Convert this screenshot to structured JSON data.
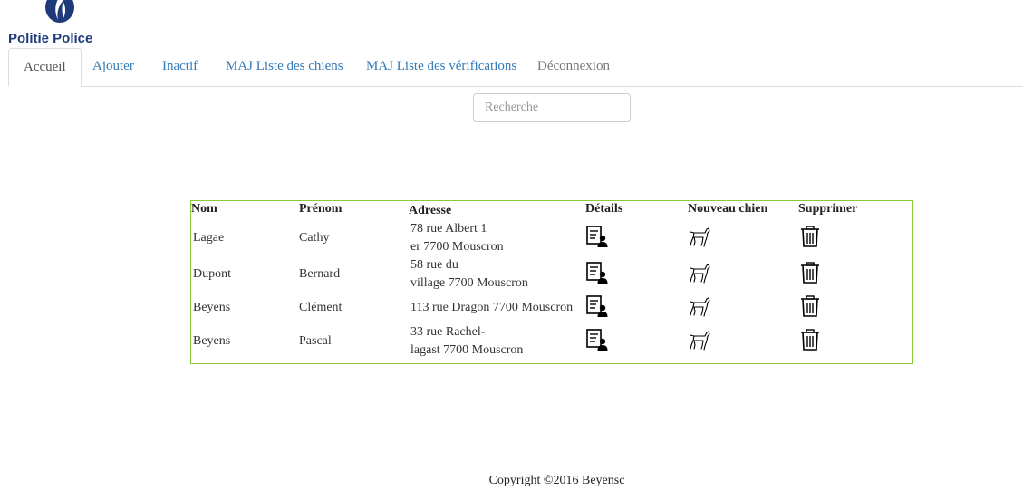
{
  "brand": {
    "logo_icon": "police-logo-icon",
    "name": "Politie Police",
    "color": "#1f3a7a"
  },
  "nav": {
    "tabs": [
      {
        "label": "Accueil",
        "active": true
      },
      {
        "label": "Ajouter"
      },
      {
        "label": "Inactif"
      },
      {
        "label": "MAJ Liste des chiens"
      },
      {
        "label": "MAJ Liste des vérifications"
      },
      {
        "label": "Déconnexion"
      }
    ]
  },
  "search": {
    "placeholder": "Recherche",
    "value": ""
  },
  "table": {
    "headers": {
      "nom": "Nom",
      "prenom": "Prénom",
      "adresse": "Adresse",
      "details": "Détails",
      "nouveau_chien": "Nouveau chien",
      "supprimer": "Supprimer"
    },
    "rows": [
      {
        "nom": "Lagae",
        "prenom": "Cathy",
        "adresse_line1": "78  rue  Albert 1",
        "adresse_line2": "er 7700 Mouscron"
      },
      {
        "nom": "Dupont",
        "prenom": "Bernard",
        "adresse_line1": "58  rue   du",
        "adresse_line2": "village 7700 Mouscron"
      },
      {
        "nom": "Beyens",
        "prenom": "Clément",
        "adresse_line1": "113  rue  Dragon 7700 Mouscron",
        "adresse_line2": ""
      },
      {
        "nom": "Beyens",
        "prenom": "Pascal",
        "adresse_line1": "33  rue  Rachel-",
        "adresse_line2": "lagast 7700 Mouscron"
      }
    ],
    "icons": {
      "details": "person-document-icon",
      "new_dog": "dog-icon",
      "delete": "trash-icon"
    },
    "border_color": "#8dc63f"
  },
  "footer": {
    "copyright": "Copyright ©2016 Beyensc"
  }
}
